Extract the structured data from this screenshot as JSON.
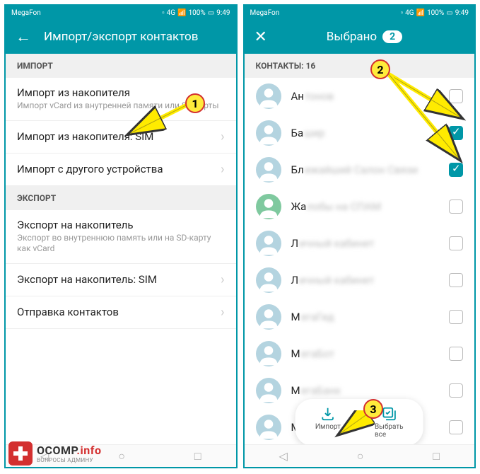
{
  "status": {
    "carrier": "MegaFon",
    "battery": "100%",
    "time": "9:49",
    "network": "4G"
  },
  "left": {
    "title": "Импорт/экспорт контактов",
    "sections": {
      "import": "ИМПОРТ",
      "export": "ЭКСПОРТ"
    },
    "items": {
      "storage_import": {
        "title": "Импорт из накопителя",
        "sub": "Импорт vCard из внутренней памяти или SD-карты"
      },
      "sim_import": {
        "title": "Импорт из накопителя: SIM"
      },
      "other_device": {
        "title": "Импорт с другого устройства"
      },
      "storage_export": {
        "title": "Экспорт на накопитель",
        "sub": "Экспорт во внутреннюю память или на SD-карту как vCard"
      },
      "sim_export": {
        "title": "Экспорт на накопитель: SIM"
      },
      "send": {
        "title": "Отправка контактов"
      }
    }
  },
  "right": {
    "title": "Выбрано",
    "selected_count": "2",
    "section": "КОНТАКТЫ: 16",
    "contacts": [
      {
        "prefix": "Ан",
        "blur": "тонов",
        "checked": false
      },
      {
        "prefix": "Ба",
        "blur": "шир",
        "checked": true
      },
      {
        "prefix": "Бл",
        "blur": "ижайший Салон Связи",
        "checked": true
      },
      {
        "prefix": "Жа",
        "blur": "лобы на СПАМ",
        "checked": false
      },
      {
        "prefix": "Л",
        "blur": "ичный кабинет",
        "checked": false
      },
      {
        "prefix": "Л",
        "blur": "ичный кабинет",
        "checked": false
      },
      {
        "prefix": "М",
        "blur": "егаГид",
        "checked": false
      },
      {
        "prefix": "М",
        "blur": "егаБот",
        "checked": false
      },
      {
        "prefix": "М",
        "blur": "егаБанк",
        "checked": false
      },
      {
        "prefix": "М",
        "blur": "обильные",
        "checked": false
      }
    ],
    "bottom": {
      "import": "Импорт",
      "select_all": "Выбрать все"
    }
  },
  "markers": {
    "m1": "1",
    "m2": "2",
    "m3": "3"
  },
  "logo": {
    "main": "OCOMP",
    "info": ".info",
    "sub": "ВОПРОСЫ АДМИНУ"
  },
  "avatar_colors": [
    "#b4d4e0",
    "#b4d4e0",
    "#b4d4e0",
    "#7fc99f",
    "#b4d4e0",
    "#b4d4e0",
    "#b4d4e0",
    "#b4d4e0",
    "#b4d4e0",
    "#b4d4e0"
  ]
}
